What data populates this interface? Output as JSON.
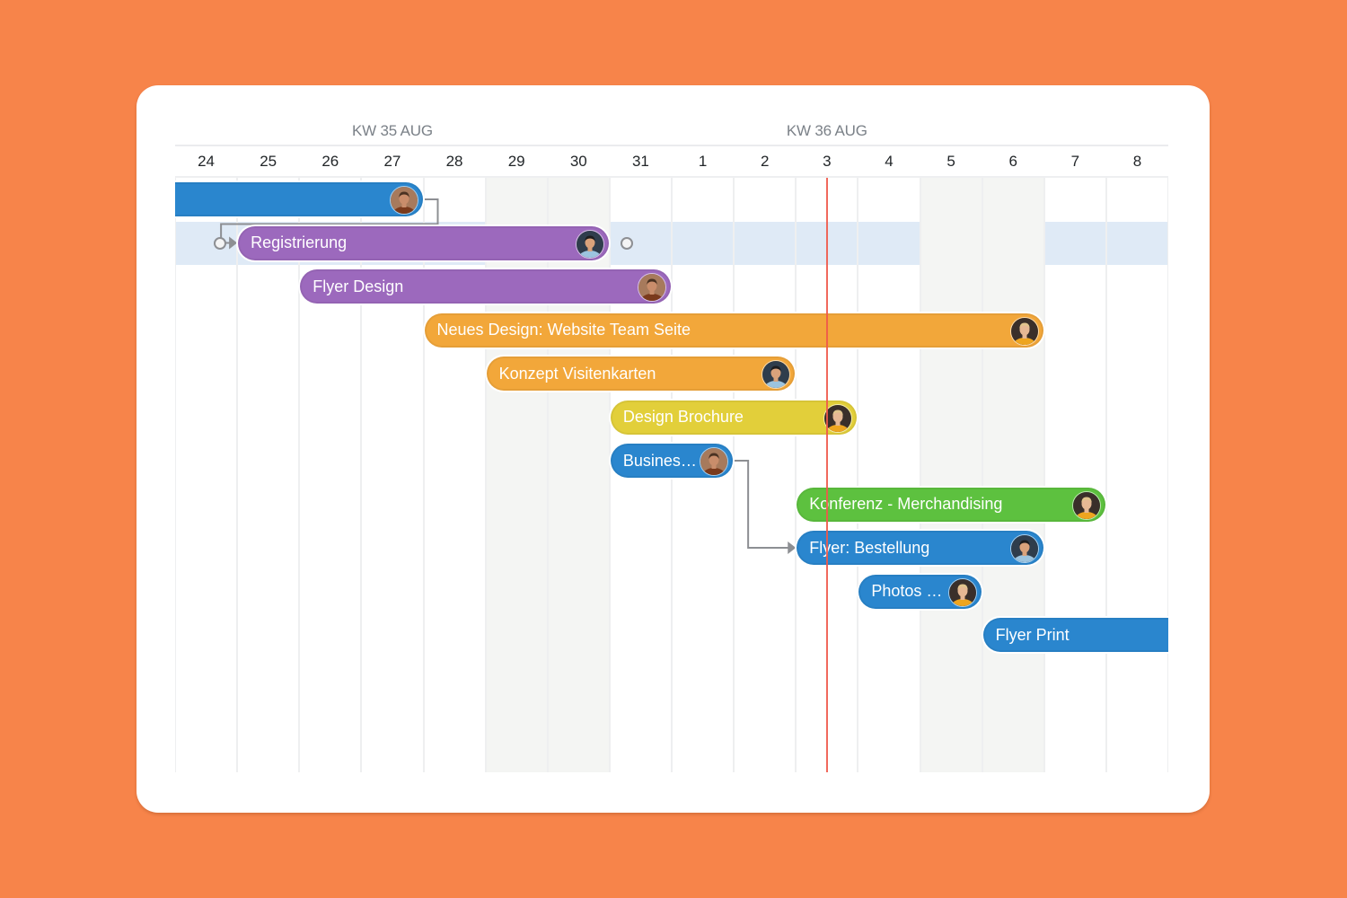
{
  "timeline": {
    "weeks": [
      {
        "label": "KW 35 AUG",
        "center_day_index": 3.5
      },
      {
        "label": "KW 36 AUG",
        "center_day_index": 10.5
      }
    ],
    "days": [
      "24",
      "25",
      "26",
      "27",
      "28",
      "29",
      "30",
      "31",
      "1",
      "2",
      "3",
      "4",
      "5",
      "6",
      "7",
      "8"
    ],
    "weekend_day_indices": [
      5,
      6,
      12,
      13
    ],
    "today_day_index": 10.5,
    "selected_row": 1
  },
  "colors": {
    "blue": "#2a86ce",
    "purple": "#9c69bd",
    "orange": "#f2a73a",
    "yellow": "#e2cf3a",
    "green": "#5dc13f",
    "today": "#f0594a",
    "background": "#f7844a"
  },
  "people": {
    "bearded-man": {
      "skin": "#c98d6b",
      "hair": "#4a3222",
      "shirt": "#7a3a1c",
      "bg": "#a77a5c"
    },
    "smiling-man": {
      "skin": "#d9a27b",
      "hair": "#1d1d1f",
      "shirt": "#9cc4df",
      "bg": "#2f3d4c"
    },
    "blonde-woman": {
      "skin": "#e6b894",
      "hair": "#e0c48d",
      "shirt": "#eea51f",
      "bg": "#3a2f2a"
    }
  },
  "tasks": [
    {
      "label": "",
      "color": "blue",
      "start": -1,
      "end": 4,
      "row": 0,
      "assignee": "bearded-man"
    },
    {
      "label": "Registrierung",
      "color": "purple",
      "start": 1,
      "end": 7,
      "row": 1,
      "assignee": "smiling-man"
    },
    {
      "label": "Flyer Design",
      "color": "purple",
      "start": 2,
      "end": 8,
      "row": 2,
      "assignee": "bearded-man"
    },
    {
      "label": "Neues Design: Website Team Seite",
      "color": "orange",
      "start": 4,
      "end": 14,
      "row": 3,
      "assignee": "blonde-woman"
    },
    {
      "label": "Konzept Visitenkarten",
      "color": "orange",
      "start": 5,
      "end": 10,
      "row": 4,
      "assignee": "smiling-man"
    },
    {
      "label": "Design Brochure",
      "color": "yellow",
      "start": 7,
      "end": 11,
      "row": 5,
      "assignee": "blonde-woman"
    },
    {
      "label": "Busines…",
      "color": "blue",
      "start": 7,
      "end": 9,
      "row": 6,
      "assignee": "bearded-man"
    },
    {
      "label": "Konferenz - Merchandising",
      "color": "green",
      "start": 10,
      "end": 15,
      "row": 7,
      "assignee": "blonde-woman"
    },
    {
      "label": "Flyer: Bestellung",
      "color": "blue",
      "start": 10,
      "end": 14,
      "row": 8,
      "assignee": "smiling-man"
    },
    {
      "label": "Photos …",
      "color": "blue",
      "start": 11,
      "end": 13,
      "row": 9,
      "assignee": "blonde-woman"
    },
    {
      "label": "Flyer Print",
      "color": "blue",
      "start": 13,
      "end": 17,
      "row": 10,
      "assignee": null
    }
  ],
  "dependencies": [
    {
      "from": 0,
      "to": 1
    },
    {
      "from": 6,
      "to": 8
    }
  ]
}
